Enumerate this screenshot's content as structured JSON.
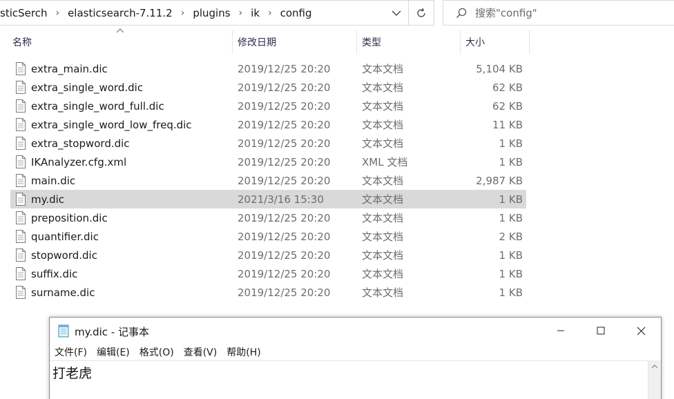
{
  "address": {
    "crumbs": [
      "sticSerch",
      "elasticsearch-7.11.2",
      "plugins",
      "ik",
      "config"
    ]
  },
  "search": {
    "placeholder": "搜索\"config\""
  },
  "columns": {
    "name": "名称",
    "date": "修改日期",
    "type": "类型",
    "size": "大小"
  },
  "files": [
    {
      "name": "extra_main.dic",
      "date": "2019/12/25 20:20",
      "type": "文本文档",
      "size": "5,104 KB"
    },
    {
      "name": "extra_single_word.dic",
      "date": "2019/12/25 20:20",
      "type": "文本文档",
      "size": "62 KB"
    },
    {
      "name": "extra_single_word_full.dic",
      "date": "2019/12/25 20:20",
      "type": "文本文档",
      "size": "62 KB"
    },
    {
      "name": "extra_single_word_low_freq.dic",
      "date": "2019/12/25 20:20",
      "type": "文本文档",
      "size": "11 KB"
    },
    {
      "name": "extra_stopword.dic",
      "date": "2019/12/25 20:20",
      "type": "文本文档",
      "size": "1 KB"
    },
    {
      "name": "IKAnalyzer.cfg.xml",
      "date": "2019/12/25 20:20",
      "type": "XML 文档",
      "size": "1 KB"
    },
    {
      "name": "main.dic",
      "date": "2019/12/25 20:20",
      "type": "文本文档",
      "size": "2,987 KB"
    },
    {
      "name": "my.dic",
      "date": "2021/3/16 15:30",
      "type": "文本文档",
      "size": "1 KB",
      "selected": true
    },
    {
      "name": "preposition.dic",
      "date": "2019/12/25 20:20",
      "type": "文本文档",
      "size": "1 KB"
    },
    {
      "name": "quantifier.dic",
      "date": "2019/12/25 20:20",
      "type": "文本文档",
      "size": "2 KB"
    },
    {
      "name": "stopword.dic",
      "date": "2019/12/25 20:20",
      "type": "文本文档",
      "size": "1 KB"
    },
    {
      "name": "suffix.dic",
      "date": "2019/12/25 20:20",
      "type": "文本文档",
      "size": "1 KB"
    },
    {
      "name": "surname.dic",
      "date": "2019/12/25 20:20",
      "type": "文本文档",
      "size": "1 KB"
    }
  ],
  "notepad": {
    "title": "my.dic - 记事本",
    "menu": [
      "文件(F)",
      "编辑(E)",
      "格式(O)",
      "查看(V)",
      "帮助(H)"
    ],
    "content": "打老虎"
  },
  "colors": {
    "selected_row": "#d9d9d9",
    "header_text": "#2b2b4a"
  },
  "icons": {
    "file": "text-file-icon",
    "notepad": "notepad-icon",
    "search": "search-icon",
    "refresh": "refresh-icon"
  }
}
